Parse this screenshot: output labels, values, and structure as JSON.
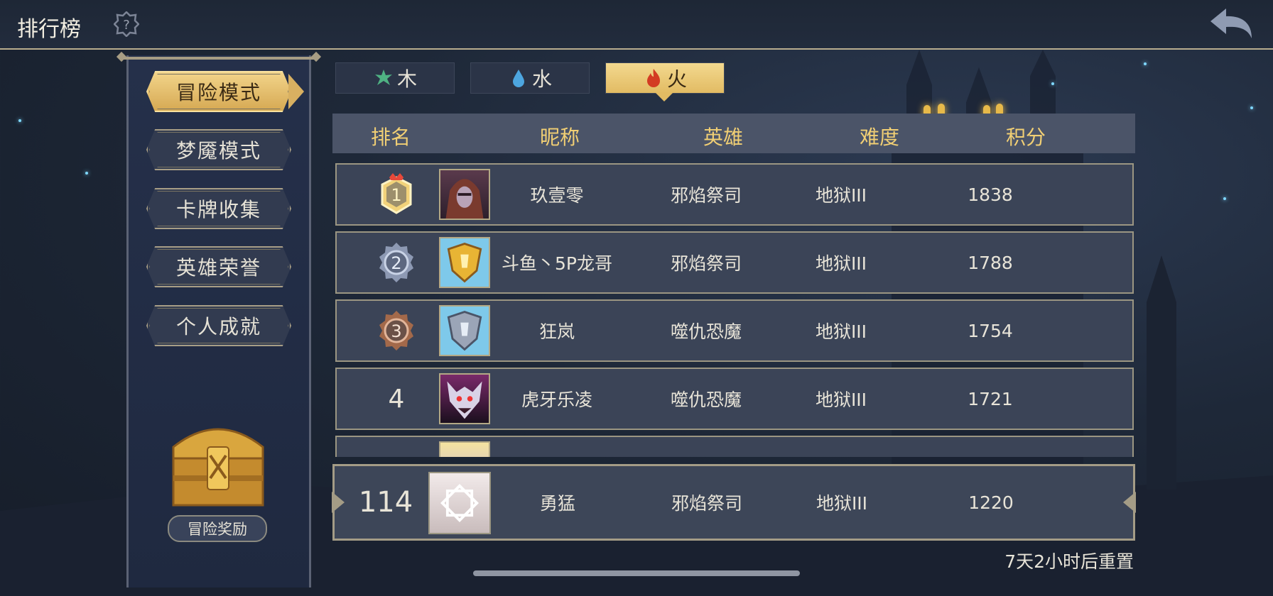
{
  "header": {
    "title": "排行榜",
    "help_icon": "question-gear-icon",
    "back_icon": "back-arrow-icon"
  },
  "sidebar": {
    "items": [
      {
        "label": "冒险模式",
        "active": true
      },
      {
        "label": "梦魇模式",
        "active": false
      },
      {
        "label": "卡牌收集",
        "active": false
      },
      {
        "label": "英雄荣誉",
        "active": false
      },
      {
        "label": "个人成就",
        "active": false
      }
    ],
    "reward_label": "冒险奖励"
  },
  "tabs": [
    {
      "label": "木",
      "icon": "leaf-icon",
      "active": false
    },
    {
      "label": "水",
      "icon": "water-drop-icon",
      "active": false
    },
    {
      "label": "火",
      "icon": "fire-icon",
      "active": true
    }
  ],
  "table": {
    "headers": [
      "排名",
      "昵称",
      "英雄",
      "难度",
      "积分"
    ],
    "rows": [
      {
        "rank": "1",
        "name": "玖壹零",
        "hero": "邪焰祭司",
        "difficulty": "地狱III",
        "score": "1838"
      },
      {
        "rank": "2",
        "name": "斗鱼丶5P龙哥",
        "hero": "邪焰祭司",
        "difficulty": "地狱III",
        "score": "1788"
      },
      {
        "rank": "3",
        "name": "狂岚",
        "hero": "噬仇恐魔",
        "difficulty": "地狱III",
        "score": "1754"
      },
      {
        "rank": "4",
        "name": "虎牙乐凌",
        "hero": "噬仇恐魔",
        "difficulty": "地狱III",
        "score": "1721"
      }
    ]
  },
  "self": {
    "rank": "114",
    "name": "勇猛",
    "hero": "邪焰祭司",
    "difficulty": "地狱III",
    "score": "1220"
  },
  "reset_text": "7天2小时后重置",
  "colors": {
    "gold": "#f1cf74",
    "accent": "#e2bb63",
    "panel": "#3b4457"
  }
}
